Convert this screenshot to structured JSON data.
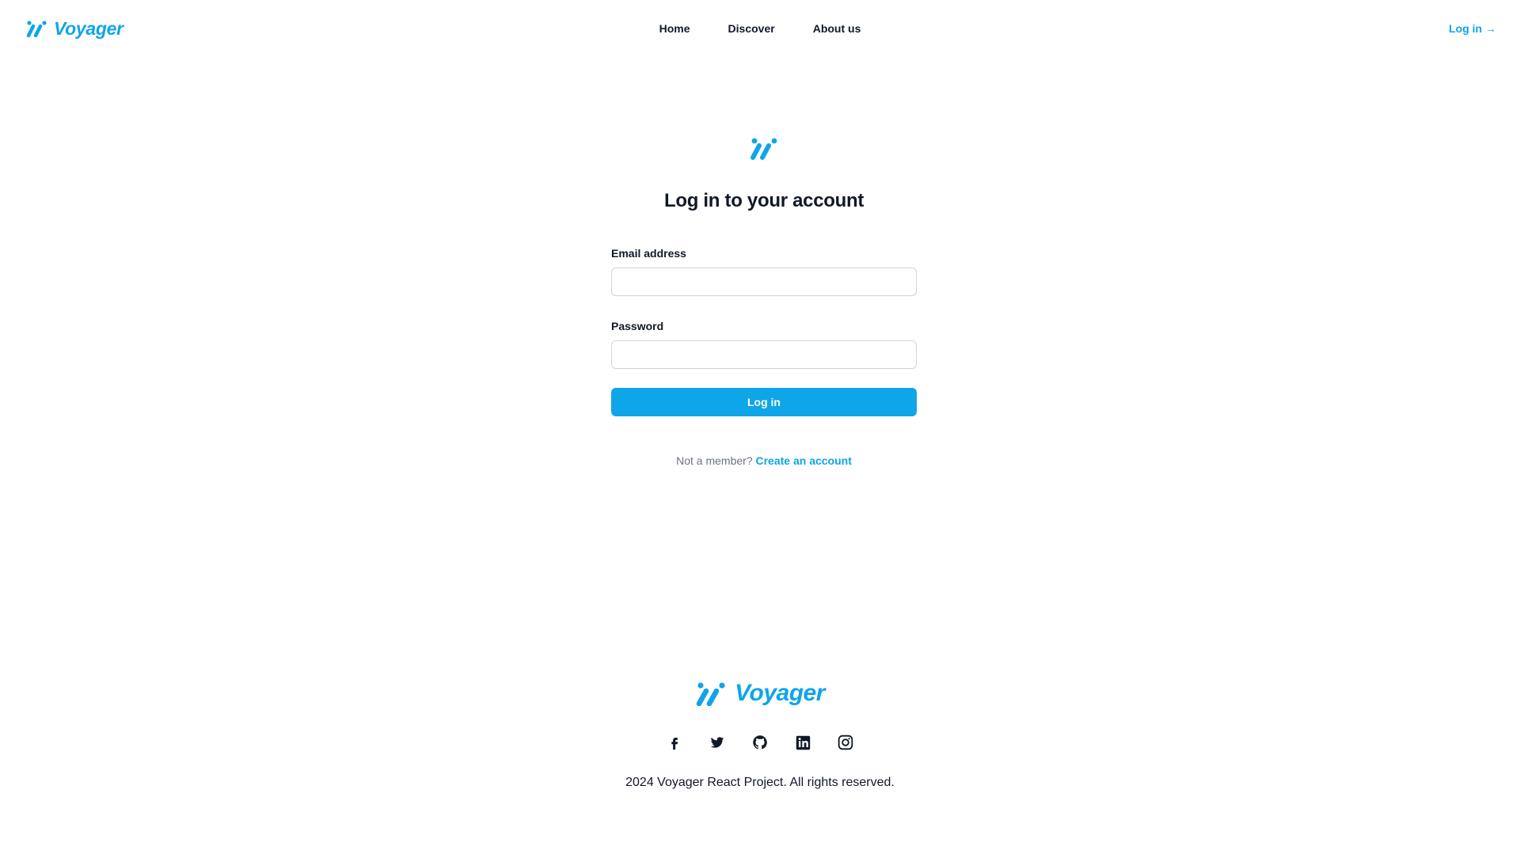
{
  "colors": {
    "brand": "#0ea5e9",
    "text": "#111827",
    "muted": "#6b7280"
  },
  "header": {
    "brand_name": "Voyager",
    "nav": [
      {
        "label": "Home"
      },
      {
        "label": "Discover"
      },
      {
        "label": "About us"
      }
    ],
    "login_link": "Log in →"
  },
  "login": {
    "logo_icon": "voyager-logo-icon",
    "title": "Log in to your account",
    "email": {
      "label": "Email address",
      "value": "",
      "placeholder": ""
    },
    "password": {
      "label": "Password",
      "value": "",
      "placeholder": ""
    },
    "submit_label": "Log in",
    "signup_prompt": "Not a member?",
    "signup_link": "Create an account"
  },
  "footer": {
    "brand_name": "Voyager",
    "socials": [
      {
        "icon": "facebook-icon"
      },
      {
        "icon": "twitter-icon"
      },
      {
        "icon": "github-icon"
      },
      {
        "icon": "linkedin-icon"
      },
      {
        "icon": "instagram-icon"
      }
    ],
    "copyright": "2024 Voyager React Project. All rights reserved."
  }
}
